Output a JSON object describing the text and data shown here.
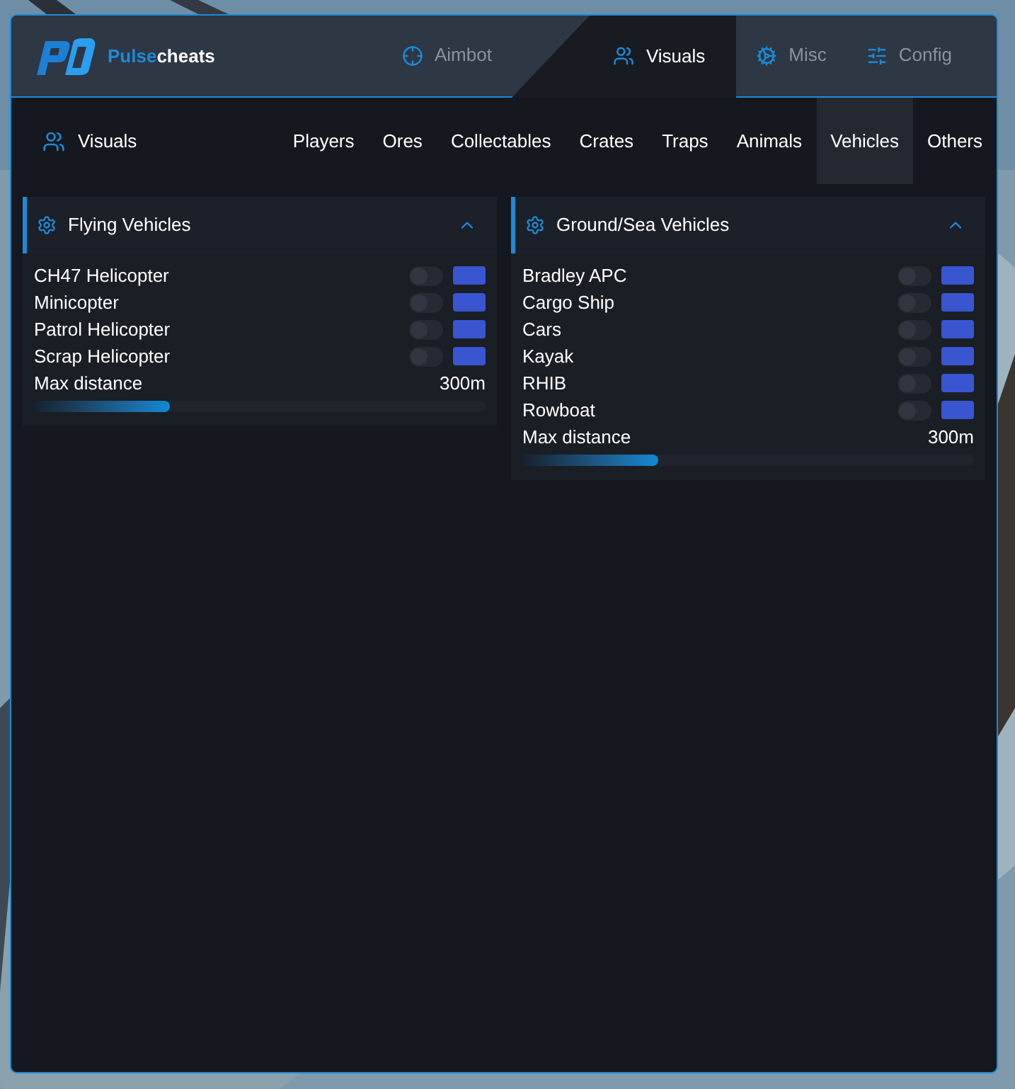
{
  "logo": {
    "accent": "Pulse",
    "rest": "cheats"
  },
  "tabs": [
    {
      "label": "Aimbot",
      "selected": false
    },
    {
      "label": "Visuals",
      "selected": true
    },
    {
      "label": "Misc",
      "selected": false
    },
    {
      "label": "Config",
      "selected": false
    }
  ],
  "section": {
    "title": "Visuals"
  },
  "subtabs": [
    {
      "label": "Players",
      "selected": false
    },
    {
      "label": "Ores",
      "selected": false
    },
    {
      "label": "Collectables",
      "selected": false
    },
    {
      "label": "Crates",
      "selected": false
    },
    {
      "label": "Traps",
      "selected": false
    },
    {
      "label": "Animals",
      "selected": false
    },
    {
      "label": "Vehicles",
      "selected": true
    },
    {
      "label": "Others",
      "selected": false
    }
  ],
  "panels": [
    {
      "title": "Flying Vehicles",
      "expanded": true,
      "items": [
        {
          "label": "CH47 Helicopter",
          "on": false,
          "color": "#3a55d0"
        },
        {
          "label": "Minicopter",
          "on": false,
          "color": "#3a55d0"
        },
        {
          "label": "Patrol Helicopter",
          "on": false,
          "color": "#3a55d0"
        },
        {
          "label": "Scrap Helicopter",
          "on": false,
          "color": "#3a55d0"
        }
      ],
      "distance": {
        "label": "Max distance",
        "reading": "300m",
        "level": 0.3
      }
    },
    {
      "title": "Ground/Sea Vehicles",
      "expanded": true,
      "items": [
        {
          "label": "Bradley APC",
          "on": false,
          "color": "#3a55d0"
        },
        {
          "label": "Cargo Ship",
          "on": false,
          "color": "#3a55d0"
        },
        {
          "label": "Cars",
          "on": false,
          "color": "#3a55d0"
        },
        {
          "label": "Kayak",
          "on": false,
          "color": "#3a55d0"
        },
        {
          "label": "RHIB",
          "on": false,
          "color": "#3a55d0"
        },
        {
          "label": "Rowboat",
          "on": false,
          "color": "#3a55d0"
        }
      ],
      "distance": {
        "label": "Max distance",
        "reading": "300m",
        "level": 0.3
      }
    }
  ]
}
